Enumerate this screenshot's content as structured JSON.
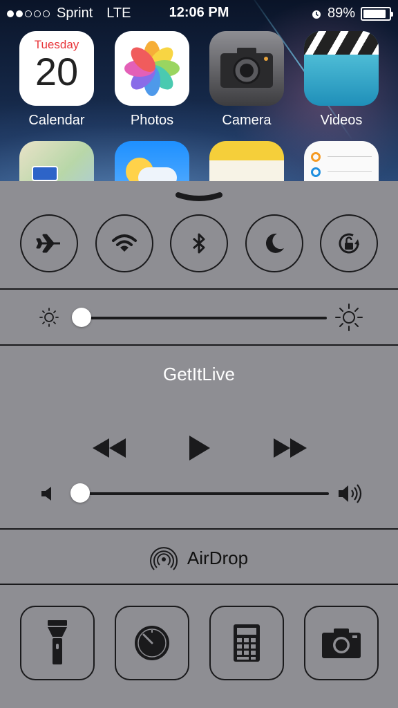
{
  "status_bar": {
    "signal_bars_filled": 2,
    "signal_bars_total": 5,
    "carrier": "Sprint",
    "network": "LTE",
    "time": "12:06 PM",
    "battery": "89%",
    "battery_level": 0.89
  },
  "home_apps": [
    {
      "label": "Calendar",
      "day": "Tuesday",
      "date": "20",
      "icon": "calendar-icon"
    },
    {
      "label": "Photos",
      "icon": "photos-icon"
    },
    {
      "label": "Camera",
      "icon": "camera-icon"
    },
    {
      "label": "Videos",
      "icon": "videos-icon"
    }
  ],
  "control_center": {
    "toggles": [
      {
        "name": "airplane-mode",
        "icon": "airplane-icon"
      },
      {
        "name": "wifi",
        "icon": "wifi-icon"
      },
      {
        "name": "bluetooth",
        "icon": "bluetooth-icon"
      },
      {
        "name": "do-not-disturb",
        "icon": "moon-icon"
      },
      {
        "name": "rotation-lock",
        "icon": "rotation-lock-icon"
      }
    ],
    "brightness_level": 0.0,
    "now_playing": "GetItLive",
    "volume_level": 0.0,
    "airdrop_label": "AirDrop",
    "shortcuts": [
      {
        "name": "flashlight",
        "icon": "flashlight-icon"
      },
      {
        "name": "timer",
        "icon": "clock-icon"
      },
      {
        "name": "calculator",
        "icon": "calculator-icon"
      },
      {
        "name": "camera",
        "icon": "camera-icon"
      }
    ]
  },
  "colors": {
    "panel": "#8e8e93",
    "ink": "#1a1a1c",
    "calendar_red": "#e8363a"
  }
}
